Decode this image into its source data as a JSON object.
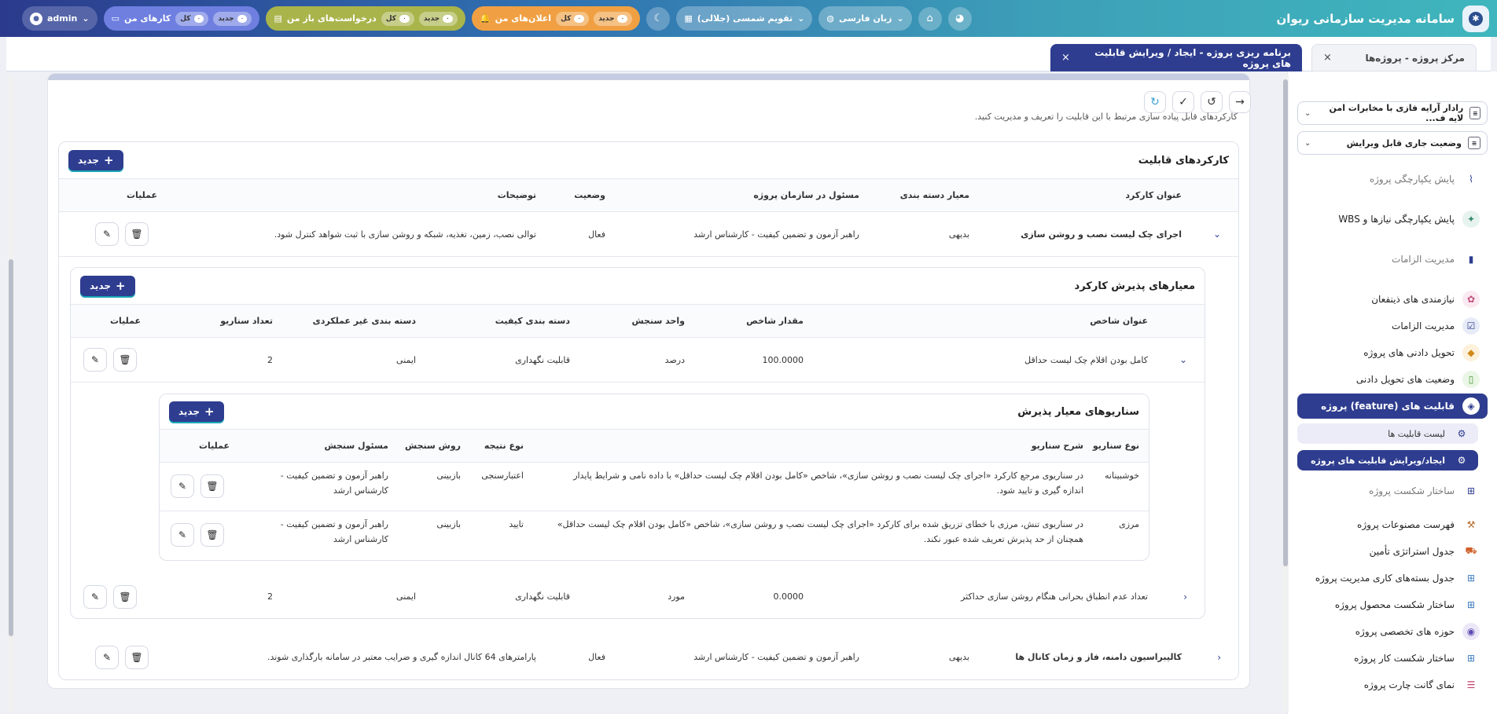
{
  "app": {
    "title": "سامانه مدیریت سازمانی ریوان"
  },
  "topbar": {
    "admin": "admin",
    "tasks": {
      "label": "کارهای من",
      "all": "کل",
      "all_count": "۰",
      "new": "جدید",
      "new_count": "۰"
    },
    "requests": {
      "label": "درخواست‌های باز من",
      "all": "کل",
      "all_count": "۰",
      "new": "جدید",
      "new_count": "۰"
    },
    "notifications": {
      "label": "اعلان‌های من",
      "all": "کل",
      "all_count": "۰",
      "new": "جدید",
      "new_count": "۰"
    },
    "calendar": "تقویم  شمسی (جلالی)",
    "language": "زبان  فارسی"
  },
  "tabs": [
    {
      "label": "مرکز پروژه  -  پروژه‌ها",
      "close": "×"
    },
    {
      "label": "برنامه ریزی پروژه  -  ایجاد / ویرایش قابلیت های پروژه",
      "close": "×"
    }
  ],
  "sidebar": {
    "project_select": "رادار آرایه فازی با مخابرات امن لایه ف...",
    "status_select": "وضعیت جاری قابل ویرایش",
    "items": [
      {
        "label": "پایش یکپارچگی پروژه"
      },
      {
        "label": "پایش یکپارچگی نیازها و WBS"
      },
      {
        "label": "مدیریت الزامات"
      },
      {
        "label": "نیازمندی های ذینفعان"
      },
      {
        "label": "مدیریت الزامات"
      },
      {
        "label": "تحویل دادنی های پروژه"
      },
      {
        "label": "وضعیت های تحویل دادنی"
      },
      {
        "label": "قابلیت های (feature) پروژه"
      },
      {
        "label": "لیست قابلیت ها"
      },
      {
        "label": "ایجاد/ویرایش قابلیت های پروژه"
      },
      {
        "label": "ساختار شکست پروژه"
      },
      {
        "label": "فهرست مصنوعات پروژه"
      },
      {
        "label": "جدول استراتژی تأمین"
      },
      {
        "label": "جدول بسته‌های کاری مدیریت پروژه"
      },
      {
        "label": "ساختار شکست محصول پروژه"
      },
      {
        "label": "حوزه های تخصصی پروژه"
      },
      {
        "label": "ساختار شکست کار پروژه"
      },
      {
        "label": "نمای گانت چارت پروژه"
      }
    ]
  },
  "main": {
    "description_partial": "کارکردهای قابل پیاده سازی مرتبط با این قابلیت را تعریف و مدیریت کنید.",
    "functions": {
      "title": "کارکردهای قابلیت",
      "new_label": "جدید",
      "headers": [
        "عنوان کارکرد",
        "معیار دسته بندی",
        "مسئول در سازمان پروژه",
        "وضعیت",
        "توضیحات",
        "عملیات"
      ],
      "rows": [
        {
          "title": "اجرای چک لیست نصب و روشن سازی",
          "category": "بدیهی",
          "owner": "راهبر آزمون و تضمین کیفیت - کارشناس ارشد",
          "status": "فعال",
          "desc": "توالی نصب، زمین، تغذیه، شبکه و روشن سازی با ثبت شواهد کنترل شود."
        },
        {
          "title": "کالیبراسیون دامنه، فاز و زمان کانال ها",
          "category": "بدیهی",
          "owner": "راهبر آزمون و تضمین کیفیت - کارشناس ارشد",
          "status": "فعال",
          "desc": "پارامترهای 64 کانال اندازه گیری و ضرایب معتبر در سامانه بارگذاری شوند."
        }
      ]
    },
    "criteria": {
      "title": "معیارهای پذیرش کارکرد",
      "new_label": "جدید",
      "headers": [
        "عنوان شاخص",
        "مقدار شاخص",
        "واحد سنجش",
        "دسته بندی کیفیت",
        "دسته بندی غیر عملکردی",
        "تعداد سناریو",
        "عملیات"
      ],
      "rows": [
        {
          "title": "کامل بودن اقلام چک لیست حداقل",
          "value": "100.0000",
          "unit": "درصد",
          "quality": "قابلیت نگهداری",
          "nonfunc": "ایمنی",
          "count": "2"
        },
        {
          "title": "تعداد عدم انطباق بحرانی هنگام روشن سازی حداکثر",
          "value": "0.0000",
          "unit": "مورد",
          "quality": "قابلیت نگهداری",
          "nonfunc": "ایمنی",
          "count": "2"
        }
      ]
    },
    "scenarios": {
      "title": "سناریوهای معیار پذیرش",
      "new_label": "جدید",
      "headers": [
        "نوع سناریو",
        "شرح سناریو",
        "نوع نتیجه",
        "روش سنجش",
        "مسئول سنجش",
        "عملیات"
      ],
      "rows": [
        {
          "type": "خوشبینانه",
          "desc1": "در سناریوی مرجع کارکرد «اجرای چک لیست نصب و روشن سازی»، شاخص «کامل بودن اقلام چک لیست حداقل» با داده نامی و شرایط پایدار",
          "desc2": "اندازه گیری و تایید شود.",
          "result": "اعتبارسنجی",
          "method": "بازبینی",
          "owner1": "راهبر آزمون و تضمین کیفیت -",
          "owner2": "کارشناس ارشد"
        },
        {
          "type": "مرزی",
          "desc1": "در سناریوی تنش، مرزی با خطای تزریق شده برای کارکرد «اجرای چک لیست نصب و روشن سازی»، شاخص «کامل بودن اقلام چک لیست حداقل»",
          "desc2": "همچنان از حد پذیرش تعریف شده عبور نکند.",
          "result": "تایید",
          "method": "بازبینی",
          "owner1": "راهبر آزمون و تضمین کیفیت -",
          "owner2": "کارشناس ارشد"
        }
      ]
    }
  },
  "colors": {
    "primary": "#2e3d8f",
    "accent": "#3fb6bd"
  }
}
